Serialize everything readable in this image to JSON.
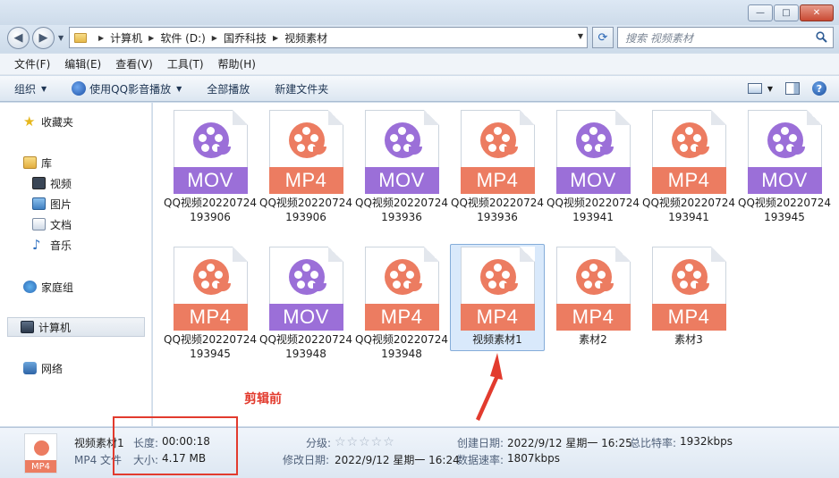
{
  "window": {
    "min_label": "—",
    "max_label": "□",
    "close_label": "✕"
  },
  "address": {
    "crumbs": [
      "计算机",
      "软件 (D:)",
      "国乔科技",
      "视频素材"
    ],
    "search_placeholder": "搜索 视频素材"
  },
  "menu": [
    "文件(F)",
    "编辑(E)",
    "查看(V)",
    "工具(T)",
    "帮助(H)"
  ],
  "toolbar": {
    "organize": "组织",
    "play_qq": "使用QQ影音播放",
    "play_all": "全部播放",
    "new_folder": "新建文件夹"
  },
  "nav": {
    "favorites": "收藏夹",
    "libraries": "库",
    "videos": "视频",
    "pictures": "图片",
    "documents": "文档",
    "music": "音乐",
    "homegroup": "家庭组",
    "computer": "计算机",
    "network": "网络"
  },
  "files": [
    {
      "ext": "MOV",
      "name": "QQ视频20220724193906"
    },
    {
      "ext": "MP4",
      "name": "QQ视频20220724193906"
    },
    {
      "ext": "MOV",
      "name": "QQ视频20220724193936"
    },
    {
      "ext": "MP4",
      "name": "QQ视频20220724193936"
    },
    {
      "ext": "MOV",
      "name": "QQ视频20220724193941"
    },
    {
      "ext": "MP4",
      "name": "QQ视频20220724193941"
    },
    {
      "ext": "MOV",
      "name": "QQ视频20220724193945"
    },
    {
      "ext": "MP4",
      "name": "QQ视频20220724193945"
    },
    {
      "ext": "MOV",
      "name": "QQ视频20220724193948"
    },
    {
      "ext": "MP4",
      "name": "QQ视频20220724193948"
    },
    {
      "ext": "MP4",
      "name": "视频素材1"
    },
    {
      "ext": "MP4",
      "name": "素材2"
    },
    {
      "ext": "MP4",
      "name": "素材3"
    }
  ],
  "annotation": "剪辑前",
  "details": {
    "name": "视频素材1",
    "type": "MP4 文件",
    "icon_ext": "MP4",
    "length_label": "长度:",
    "length_value": "00:00:18",
    "size_label": "大小:",
    "size_value": "4.17 MB",
    "rating_label": "分级:",
    "rating_stars": "☆☆☆☆☆",
    "modified_label": "修改日期:",
    "modified_value": "2022/9/12 星期一 16:24",
    "created_label": "创建日期:",
    "created_value": "2022/9/12 星期一 16:25",
    "bitrate_label": "总比特率:",
    "bitrate_value": "1932kbps",
    "datarate_label": "数据速率:",
    "datarate_value": "1807kbps"
  }
}
